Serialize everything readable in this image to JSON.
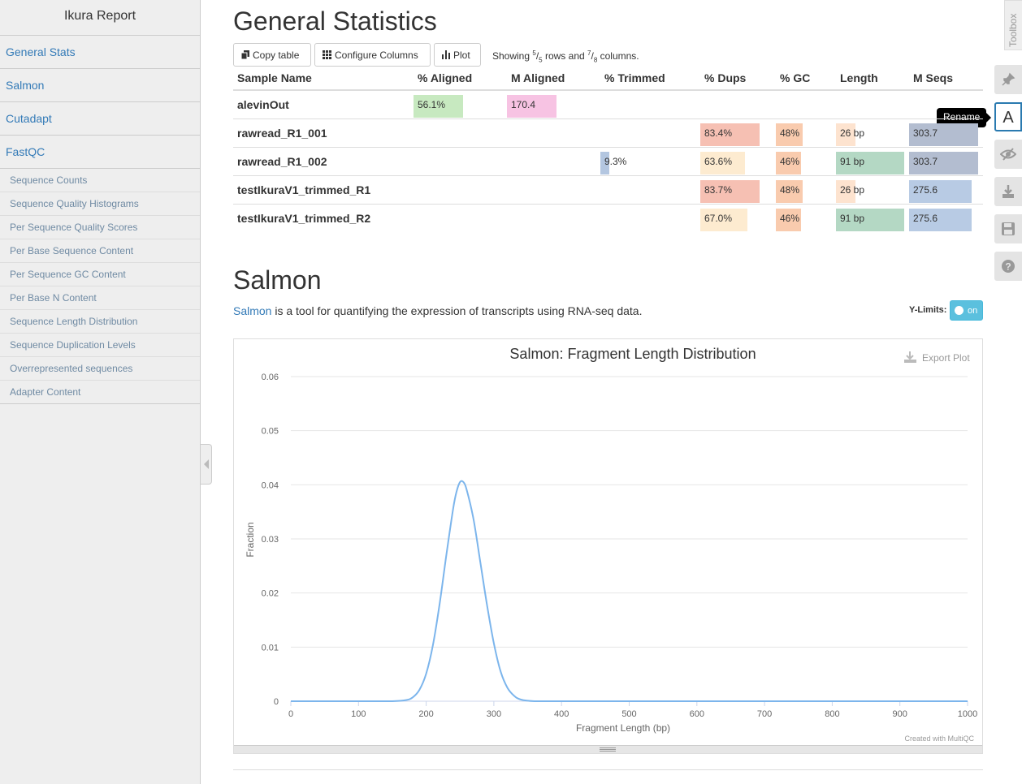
{
  "sidebar": {
    "brand": "Ikura Report",
    "top_items": [
      {
        "label": "General Stats"
      },
      {
        "label": "Salmon"
      },
      {
        "label": "Cutadapt"
      },
      {
        "label": "FastQC"
      }
    ],
    "sub_items": [
      {
        "label": "Sequence Counts"
      },
      {
        "label": "Sequence Quality Histograms"
      },
      {
        "label": "Per Sequence Quality Scores"
      },
      {
        "label": "Per Base Sequence Content"
      },
      {
        "label": "Per Sequence GC Content"
      },
      {
        "label": "Per Base N Content"
      },
      {
        "label": "Sequence Length Distribution"
      },
      {
        "label": "Sequence Duplication Levels"
      },
      {
        "label": "Overrepresented sequences"
      },
      {
        "label": "Adapter Content"
      }
    ]
  },
  "toolbox": {
    "label": "Toolbox",
    "tooltip": "Rename",
    "icons": [
      "pin-icon",
      "rename-icon",
      "hide-icon",
      "download-icon",
      "save-icon",
      "help-icon"
    ]
  },
  "general_stats": {
    "title": "General Statistics",
    "buttons": {
      "copy": "Copy table",
      "configure": "Configure Columns",
      "plot": "Plot"
    },
    "showing": {
      "prefix": "Showing",
      "rows_shown": "5",
      "rows_total": "5",
      "mid": "rows and",
      "cols_shown": "7",
      "cols_total": "8",
      "suffix": "columns."
    },
    "headers": [
      "Sample Name",
      "% Aligned",
      "M Aligned",
      "% Trimmed",
      "% Dups",
      "% GC",
      "Length",
      "M Seqs"
    ],
    "colors": {
      "aligned": "#c7e9c0",
      "m_aligned": "#f7c3e3",
      "trimmed": "#b3c6e0",
      "dups_high": "#f6c0b3",
      "dups_low": "#fdebd0",
      "gc": "#f9cbae",
      "length_short": "#fde3cf",
      "length_long": "#b4d8c4",
      "seqs_high": "#b3bdd0",
      "seqs_low": "#b8cbe4"
    },
    "rows": [
      {
        "name": "alevinOut",
        "aligned": "56.1%",
        "aligned_frac": 0.561,
        "m_aligned": "170.4",
        "m_aligned_frac": 0.56,
        "trimmed": "",
        "trimmed_frac": 0,
        "dups": "",
        "dups_frac": 0,
        "gc": "",
        "gc_frac": 0,
        "length": "",
        "length_frac": 0,
        "seqs": "",
        "seqs_frac": 0
      },
      {
        "name": "rawread_R1_001",
        "aligned": "",
        "aligned_frac": 0,
        "m_aligned": "",
        "m_aligned_frac": 0,
        "trimmed": "",
        "trimmed_frac": 0,
        "dups": "83.4%",
        "dups_frac": 0.834,
        "gc": "48%",
        "gc_frac": 0.48,
        "length": "26 bp",
        "length_frac": 0.29,
        "seqs": "303.7",
        "seqs_frac": 1.0
      },
      {
        "name": "rawread_R1_002",
        "aligned": "",
        "aligned_frac": 0,
        "m_aligned": "",
        "m_aligned_frac": 0,
        "trimmed": "9.3%",
        "trimmed_frac": 0.093,
        "dups": "63.6%",
        "dups_frac": 0.636,
        "gc": "46%",
        "gc_frac": 0.46,
        "length": "91 bp",
        "length_frac": 1.0,
        "seqs": "303.7",
        "seqs_frac": 1.0
      },
      {
        "name": "testIkuraV1_trimmed_R1",
        "aligned": "",
        "aligned_frac": 0,
        "m_aligned": "",
        "m_aligned_frac": 0,
        "trimmed": "",
        "trimmed_frac": 0,
        "dups": "83.7%",
        "dups_frac": 0.837,
        "gc": "48%",
        "gc_frac": 0.48,
        "length": "26 bp",
        "length_frac": 0.29,
        "seqs": "275.6",
        "seqs_frac": 0.907
      },
      {
        "name": "testIkuraV1_trimmed_R2",
        "aligned": "",
        "aligned_frac": 0,
        "m_aligned": "",
        "m_aligned_frac": 0,
        "trimmed": "",
        "trimmed_frac": 0,
        "dups": "67.0%",
        "dups_frac": 0.67,
        "gc": "46%",
        "gc_frac": 0.46,
        "length": "91 bp",
        "length_frac": 1.0,
        "seqs": "275.6",
        "seqs_frac": 0.907
      }
    ]
  },
  "salmon": {
    "title": "Salmon",
    "link_text": "Salmon",
    "description": "is a tool for quantifying the expression of transcripts using RNA-seq data.",
    "ylimits_label": "Y-Limits:",
    "ylimits_toggle": "on",
    "export_label": "Export Plot",
    "credit": "Created with MultiQC"
  },
  "chart_data": {
    "type": "line",
    "title": "Salmon: Fragment Length Distribution",
    "xlabel": "Fragment Length (bp)",
    "ylabel": "Fraction",
    "xlim": [
      0,
      1000
    ],
    "ylim": [
      0,
      0.06
    ],
    "x_ticks": [
      "0",
      "100",
      "200",
      "300",
      "400",
      "500",
      "600",
      "700",
      "800",
      "900",
      "1000"
    ],
    "y_ticks": [
      "0",
      "0.01",
      "0.02",
      "0.03",
      "0.04",
      "0.05",
      "0.06"
    ],
    "grid": true,
    "line_color": "#7cb5ec",
    "series": [
      {
        "x": [
          0,
          100,
          150,
          170,
          180,
          190,
          200,
          210,
          220,
          230,
          240,
          245,
          250,
          255,
          260,
          270,
          280,
          290,
          300,
          310,
          320,
          330,
          340,
          360,
          400,
          500,
          600,
          700,
          800,
          900,
          1000
        ],
        "values": [
          0,
          0,
          0,
          0.0002,
          0.0007,
          0.0021,
          0.0051,
          0.0104,
          0.0181,
          0.0272,
          0.0357,
          0.0388,
          0.0405,
          0.0405,
          0.039,
          0.0336,
          0.0257,
          0.0177,
          0.0107,
          0.0055,
          0.0025,
          0.001,
          0.0003,
          0,
          0,
          0,
          0,
          0,
          0,
          0,
          0
        ]
      }
    ]
  }
}
